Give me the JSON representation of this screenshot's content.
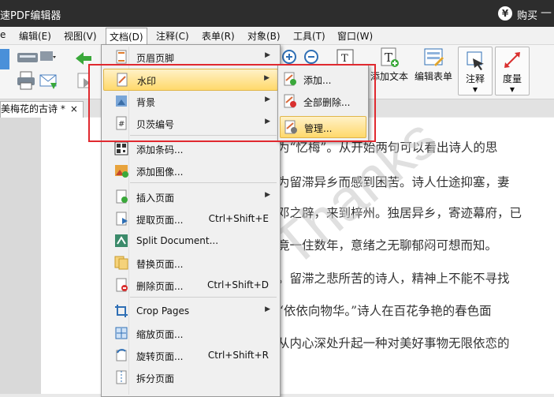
{
  "window": {
    "title": "速PDF编辑器",
    "buy_label": "购买",
    "minimize_glyph": "—"
  },
  "menubar": [
    {
      "label": "e"
    },
    {
      "label": "编辑(E)"
    },
    {
      "label": "视图(V)"
    },
    {
      "label": "文档(D)"
    },
    {
      "label": "注释(C)"
    },
    {
      "label": "表单(R)"
    },
    {
      "label": "对象(B)"
    },
    {
      "label": "工具(T)"
    },
    {
      "label": "窗口(W)"
    }
  ],
  "toolbar": {
    "add_text": "添加文本",
    "edit_form": "编辑表单",
    "annotate": "注释",
    "measure": "度量"
  },
  "tab": {
    "name": "美梅花的古诗 *",
    "close": "×"
  },
  "document": {
    "watermark_text": "Thanks",
    "lines": [
      "为“忆梅”。从开始两句可以看出诗人的思",
      "为留滞异乡而感到困苦。诗人仕途抑塞，妻",
      "邓之辟，来到梓州。独居异乡，寄迹幕府，已",
      "竟一住数年，意绪之无聊郁闷可想而知。",
      "。留滞之悲所苦的诗人，精神上不能不寻找",
      "“依依向物华。”诗人在百花争艳的春色面",
      "从内心深处升起一种对美好事物无限依恋的"
    ]
  },
  "document_menu": {
    "items": [
      {
        "label": "页眉页脚",
        "has_submenu": true
      },
      {
        "label": "水印",
        "has_submenu": true,
        "highlighted": true
      },
      {
        "label": "背景",
        "has_submenu": true
      },
      {
        "label": "贝茨编号",
        "has_submenu": true
      },
      {
        "label": "添加条码..."
      },
      {
        "label": "添加图像..."
      },
      {
        "label": "插入页面",
        "has_submenu": true
      },
      {
        "label": "提取页面...",
        "shortcut": "Ctrl+Shift+E"
      },
      {
        "label": "Split Document..."
      },
      {
        "label": "替换页面..."
      },
      {
        "label": "删除页面...",
        "shortcut": "Ctrl+Shift+D"
      },
      {
        "label": "Crop Pages",
        "has_submenu": true
      },
      {
        "label": "缩放页面..."
      },
      {
        "label": "旋转页面...",
        "shortcut": "Ctrl+Shift+R"
      },
      {
        "label": "拆分页面"
      }
    ]
  },
  "watermark_submenu": {
    "items": [
      {
        "label": "添加..."
      },
      {
        "label": "全部删除..."
      },
      {
        "label": "管理...",
        "highlighted": true
      }
    ]
  },
  "colors": {
    "titlebar": "#2d2d2d",
    "highlight_box": "#e0292f",
    "menu_highlight": "#ffd96b"
  }
}
